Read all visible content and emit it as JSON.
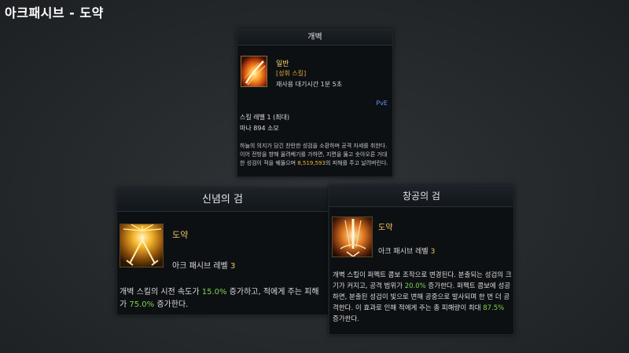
{
  "page": {
    "title": "아크패시브 - 도약"
  },
  "skill_tooltip": {
    "header": "개벽",
    "rank": "일반",
    "tag": "[성휘 스킬]",
    "cooldown": "재사용 대기시간 1분 5초",
    "mode": "PvE",
    "level": "스킬 레벨 1 (최대)",
    "mana": "마나 894 소모",
    "description": {
      "pre": "하늘의 의지가 담긴 찬란한 성검을 소환하며 공격 자세를 취한다. 이어 전방을 향해 올려베기를 가하면, 지면을 뚫고 솟아오른 거대한 성검이 적을 꿰뚫으며 ",
      "damage": "8,519,593",
      "post": "의 피해를 주고 날려버린다."
    },
    "icon": "fire-slash-icon"
  },
  "tripods": [
    {
      "header": "신념의 검",
      "name": "도약",
      "ark_level_label": "아크 패시브 레벨",
      "ark_level": "3",
      "icon": "crossed-swords-light-icon",
      "desc": {
        "p1": "개벽 스킬의 시전 속도가 ",
        "v1": "15.0%",
        "p2": " 증가하고, 적에게 주는 피해가 ",
        "v2": "75.0%",
        "p3": " 증가한다."
      }
    },
    {
      "header": "창공의 검",
      "name": "도약",
      "ark_level_label": "아크 패시브 레벨",
      "ark_level": "3",
      "icon": "sky-sword-strike-icon",
      "desc": {
        "p1": "개벽 스킬이 퍼펙트 콤보 조작으로 변경된다. 분출되는 성검의 크기가 커지고, 공격 범위가 ",
        "v1": "20.0%",
        "p2": " 증가한다. 퍼펙트 콤보에 성공하면, 분출된 성검이 빛으로 변해 공중으로 발사되며 한 번 더 공격한다. 이 효과로 인해 적에게 주는 총 피해량이 최대 ",
        "v2": "87.5%",
        "p3": " 증가한다."
      }
    }
  ],
  "colors": {
    "gold": "#f0c75a",
    "green": "#7bd54a",
    "orange": "#f2b23a",
    "pve_blue": "#6d8cff"
  }
}
